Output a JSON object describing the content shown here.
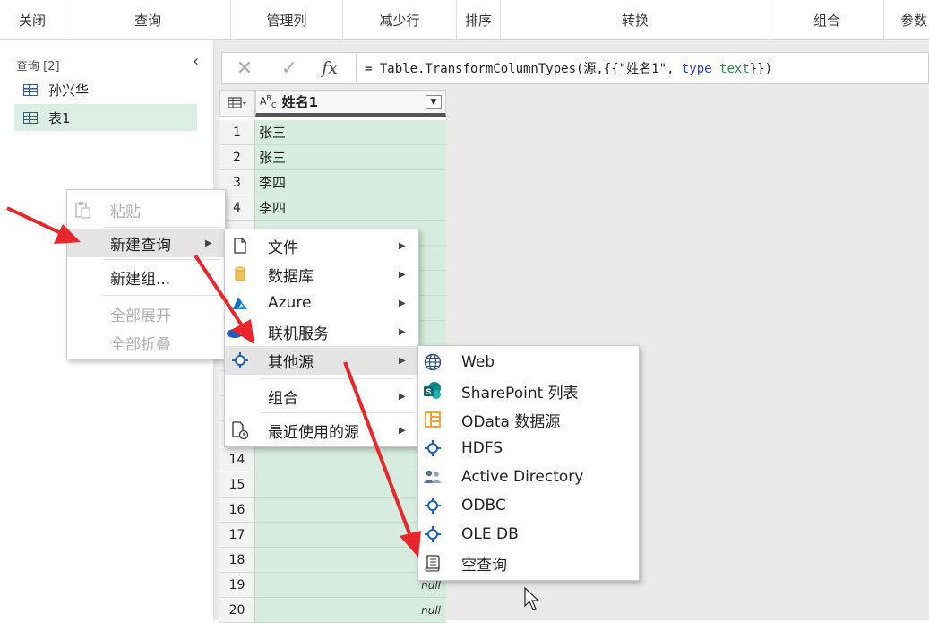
{
  "ribbon": {
    "close": "关闭",
    "query": "查询",
    "manage_columns": "管理列",
    "reduce_rows": "减少行",
    "sort": "排序",
    "transform": "转换",
    "combine": "组合",
    "params": "参数"
  },
  "queries_pane": {
    "header": "查询 [2]",
    "items": [
      {
        "label": "孙兴华",
        "selected": false
      },
      {
        "label": "表1",
        "selected": true
      }
    ]
  },
  "formula_bar": {
    "cancel_icon": "✕",
    "commit_icon": "✓",
    "fx_label": "fx",
    "formula_parts": [
      "= Table.TransformColumnTypes(源,{{\"姓名1\", ",
      "type",
      " ",
      "text",
      "}})"
    ]
  },
  "grid": {
    "column_header": "姓名1",
    "type_icon": "ABC",
    "rows": [
      {
        "num": "1",
        "value": "张三"
      },
      {
        "num": "2",
        "value": "张三"
      },
      {
        "num": "3",
        "value": "李四"
      },
      {
        "num": "4",
        "value": "李四"
      },
      {
        "num": "14",
        "value": ""
      },
      {
        "num": "15",
        "value": ""
      },
      {
        "num": "16",
        "value": ""
      },
      {
        "num": "17",
        "value": ""
      },
      {
        "num": "18",
        "value": ""
      },
      {
        "num": "19",
        "value": "null"
      },
      {
        "num": "20",
        "value": "null"
      }
    ]
  },
  "context_menu": {
    "paste": "粘贴",
    "new_query": "新建查询",
    "new_group": "新建组...",
    "expand_all": "全部展开",
    "collapse_all": "全部折叠"
  },
  "new_query_submenu": {
    "file": "文件",
    "database": "数据库",
    "azure": "Azure",
    "online_services": "联机服务",
    "other_sources": "其他源",
    "combine": "组合",
    "recent_sources": "最近使用的源"
  },
  "other_sources_submenu": [
    {
      "label": "Web",
      "icon": "globe-icon"
    },
    {
      "label": "SharePoint 列表",
      "icon": "sharepoint-icon"
    },
    {
      "label": "OData 数据源",
      "icon": "odata-icon"
    },
    {
      "label": "HDFS",
      "icon": "connector-icon"
    },
    {
      "label": "Active Directory",
      "icon": "users-icon"
    },
    {
      "label": "ODBC",
      "icon": "connector-icon"
    },
    {
      "label": "OLE DB",
      "icon": "connector-icon"
    },
    {
      "label": "空查询",
      "icon": "blank-query-icon"
    }
  ],
  "colors": {
    "selection_green": "#d6ecdf",
    "annotation_red": "#e8262c",
    "menu_highlight": "#e4e4e4"
  }
}
